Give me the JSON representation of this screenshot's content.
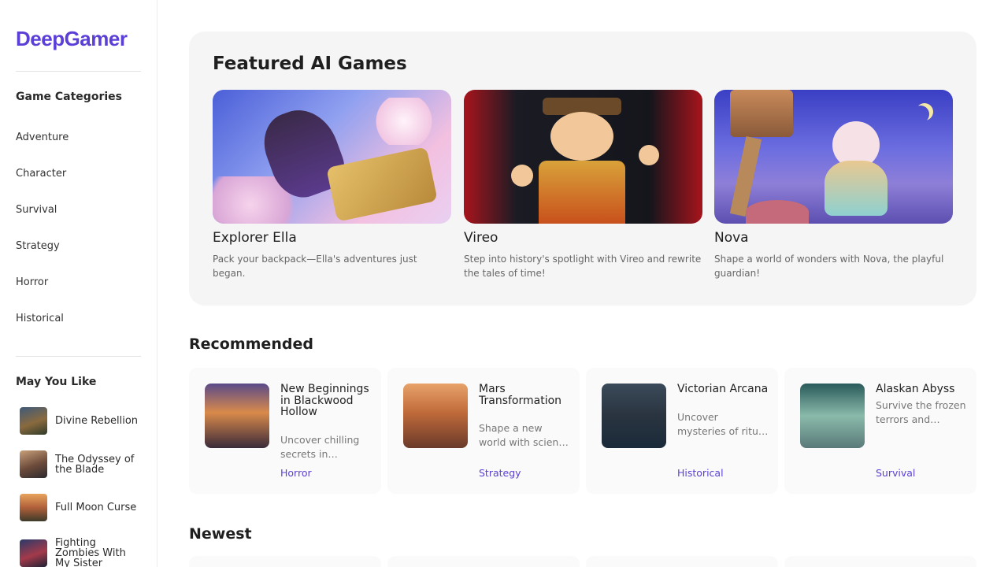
{
  "brand": {
    "logo": "DeepGamer",
    "color": "#5b3fd6"
  },
  "sidebar": {
    "categories_heading": "Game Categories",
    "categories": [
      "Adventure",
      "Character",
      "Survival",
      "Strategy",
      "Horror",
      "Historical"
    ],
    "like_heading": "May You Like",
    "likes": [
      {
        "title": "Divine Rebellion"
      },
      {
        "title": "The Odyssey of the Blade"
      },
      {
        "title": "Full Moon Curse"
      },
      {
        "title": "Fighting Zombies With My Sister"
      }
    ]
  },
  "featured": {
    "title": "Featured AI Games",
    "games": [
      {
        "name": "Explorer Ella",
        "desc": "Pack your backpack—Ella's adventures just began."
      },
      {
        "name": "Vireo",
        "desc": "Step into history's spotlight with Vireo and rewrite the tales of time!"
      },
      {
        "name": "Nova",
        "desc": "Shape a world of wonders with Nova, the playful guardian!"
      }
    ]
  },
  "recommended": {
    "title": "Recommended",
    "games": [
      {
        "title": "New Beginnings in Blackwood Hollow",
        "desc": "Uncover chilling secrets in…",
        "tag": "Horror"
      },
      {
        "title": "Mars Transformation",
        "desc": "Shape a new world with scien…",
        "tag": "Strategy"
      },
      {
        "title": "Victorian Arcana",
        "desc": "Uncover mysteries of ritu…",
        "tag": "Historical"
      },
      {
        "title": "Alaskan Abyss",
        "desc": "Survive the frozen terrors and…",
        "tag": "Survival"
      }
    ]
  },
  "newest": {
    "title": "Newest"
  }
}
